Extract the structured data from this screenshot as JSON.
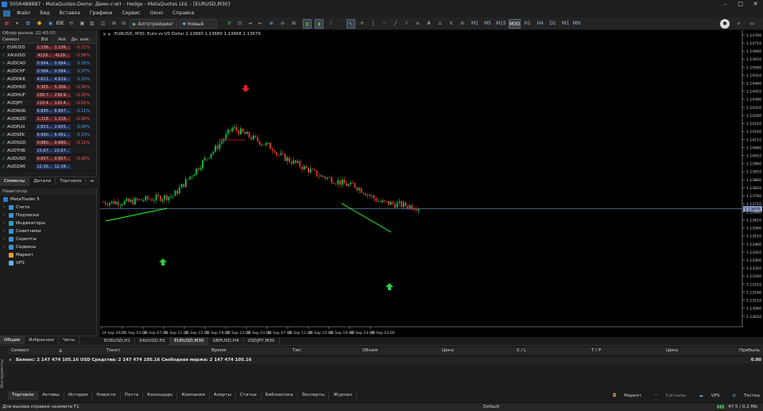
{
  "window": {
    "title": "5056488887 - MetaQuotes-Demo: Демо-счет - Hedge - MetaQuotes Ltd. - [EURUSD,M30]"
  },
  "menu": [
    "Файл",
    "Вид",
    "Вставка",
    "Графики",
    "Сервис",
    "Окно",
    "Справка"
  ],
  "toolbar": {
    "algo_label": "Алготрейдинг",
    "neworder_label": "Новый ордер",
    "ide_label": "IDE",
    "timeframes": [
      "M1",
      "M5",
      "M15",
      "M30",
      "H1",
      "H4",
      "D1",
      "W1",
      "MN"
    ],
    "selected_tf": "M30"
  },
  "market_watch": {
    "title": "Обзор рынка: 22:43:03",
    "columns": [
      "Символ",
      "Bid",
      "Ask",
      "Дн. изм."
    ],
    "rows": [
      {
        "symbol": "EURUSD",
        "bid": "1.136...",
        "ask": "1.136...",
        "chg": "-0.21%",
        "dir": "neg"
      },
      {
        "symbol": "XAUUSD",
        "bid": "4129...",
        "ask": "4129...",
        "chg": "-3.56%",
        "dir": "neg"
      },
      {
        "symbol": "AUDCAD",
        "bid": "0.994...",
        "ask": "0.994...",
        "chg": "0.16%",
        "dir": "pos"
      },
      {
        "symbol": "AUDCHF",
        "bid": "0.584...",
        "ask": "0.584...",
        "chg": "0.37%",
        "dir": "pos"
      },
      {
        "symbol": "AUDDKK",
        "bid": "4.611...",
        "ask": "4.619...",
        "chg": "0.15%",
        "dir": "pos"
      },
      {
        "symbol": "AUDHKD",
        "bid": "5.305...",
        "ask": "5.306...",
        "chg": "-0.06%",
        "dir": "neg"
      },
      {
        "symbol": "AUDHUF",
        "bid": "238.7...",
        "ask": "239.9...",
        "chg": "-0.25%",
        "dir": "neg"
      },
      {
        "symbol": "AUDJPY",
        "bid": "110.4...",
        "ask": "110.4...",
        "chg": "-0.01%",
        "dir": "neg"
      },
      {
        "symbol": "AUDNOK",
        "bid": "6.895...",
        "ask": "6.897...",
        "chg": "0.11%",
        "dir": "pos"
      },
      {
        "symbol": "AUDNZD",
        "bid": "1.218...",
        "ask": "1.218...",
        "chg": "-0.06%",
        "dir": "neg"
      },
      {
        "symbol": "AUDPLN",
        "bid": "2.653...",
        "ask": "2.655...",
        "chg": "0.08%",
        "dir": "pos"
      },
      {
        "symbol": "AUDSEK",
        "bid": "6.990...",
        "ask": "6.991...",
        "chg": "0.15%",
        "dir": "pos"
      },
      {
        "symbol": "AUDSGD",
        "bid": "0.880...",
        "ask": "0.880...",
        "chg": "-0.11%",
        "dir": "neg"
      },
      {
        "symbol": "AUDTHB",
        "bid": "23.67...",
        "ask": "23.67...",
        "chg": "",
        "dir": "pos"
      },
      {
        "symbol": "AUDUSD",
        "bid": "0.657...",
        "ask": "0.657...",
        "chg": "-0.06%",
        "dir": "neg"
      },
      {
        "symbol": "AUDZAR",
        "bid": "12.36...",
        "ask": "12.38...",
        "chg": "",
        "dir": "pos"
      }
    ],
    "tabs": [
      "Символы",
      "Детали",
      "Торговля"
    ]
  },
  "navigator": {
    "title": "Навигатор",
    "root": "MetaTrader 5",
    "items": [
      "Счета",
      "Подписки",
      "Индикаторы",
      "Советники",
      "Скрипты",
      "Сервисы",
      "Маркет",
      "VPS"
    ],
    "tabs": [
      "Общие",
      "Избранное",
      "Чаты"
    ]
  },
  "chart": {
    "title": "EURUSD, M30: Euro vs US Dollar 1.13680 1.13689 1.13668 1.13679",
    "current_price": "1.13679",
    "price_labels": [
      "1.14760",
      "1.14710",
      "1.14660",
      "1.14610",
      "1.14560",
      "1.14510",
      "1.14460",
      "1.14410",
      "1.14360",
      "1.14310",
      "1.14260",
      "1.14210",
      "1.14160",
      "1.14110",
      "1.14060",
      "1.14010",
      "1.13960",
      "1.13910",
      "1.13860",
      "1.13810",
      "1.13760",
      "1.13710",
      "1.13660",
      "1.13610",
      "1.13560",
      "1.13510",
      "1.13460",
      "1.13410",
      "1.13360",
      "1.13310",
      "1.13260",
      "1.13210",
      "1.13160",
      "1.13110",
      "1.13060",
      "1.13010"
    ],
    "time_labels": [
      "24 Sep 2025",
      "25 Sep 03:00",
      "25 Sep 07:00",
      "25 Sep 11:00",
      "25 Sep 15:00",
      "25 Sep 19:00",
      "25 Sep 23:00",
      "26 Sep 03:00",
      "26 Sep 07:00",
      "26 Sep 11:00",
      "26 Sep 15:00",
      "26 Sep 19:00",
      "28 Sep 23:00",
      "29 Sep 03:00"
    ],
    "colors": {
      "bull": "#00c853",
      "bear": "#e53935",
      "bg": "#000000",
      "trend": "#33ff33",
      "fractal_up": "#2ecc40",
      "fractal_down": "#e02020",
      "priceline": "#6e8cc8"
    }
  },
  "chart_tabs": [
    "EURUSD,H1",
    "XAUUSD,H1",
    "EURUSD,M30",
    "GBPUSD,H4",
    "USDJPY,M30"
  ],
  "terminal": {
    "columns": [
      "Символ",
      "Тикет",
      "Время",
      "Тип",
      "Объем",
      "Цена",
      "S / L",
      "T / P",
      "Цена",
      "Прибыль"
    ],
    "balance_line": "Баланс: 2 147 474 105.16 USD  Средства: 2 147 474 105.16  Свободная маржа: 2 147 474 105.16",
    "profit": "0.00",
    "side_label": "Инструменты",
    "tabs": [
      "Торговля",
      "Активы",
      "История",
      "Новости",
      "Почта",
      "Календарь",
      "Компания",
      "Алерты",
      "Статьи",
      "Библиотека",
      "Эксперты",
      "Журнал"
    ],
    "right_links": [
      "Маркет",
      "Сигналы",
      "VPS",
      "Тестер"
    ]
  },
  "status": {
    "help": "Для вызова справки нажмите F1",
    "profile": "Default",
    "net": "47.5 / 0.2 Mb"
  }
}
